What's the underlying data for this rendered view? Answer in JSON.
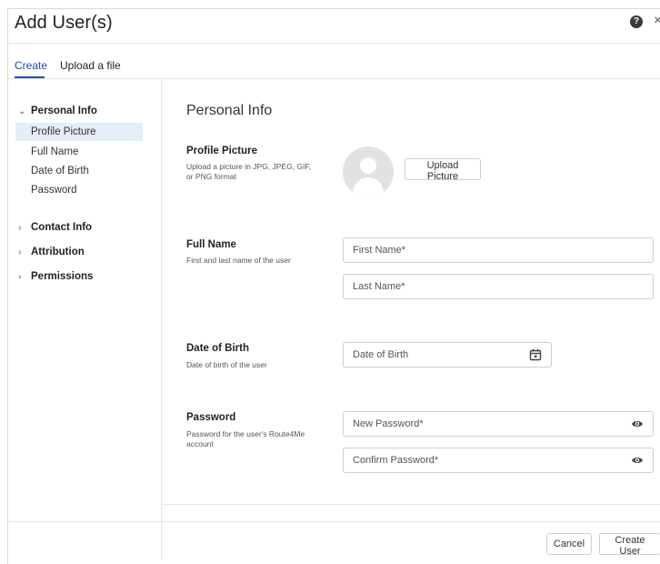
{
  "dialog": {
    "title": "Add User(s)",
    "help_icon": "help-icon",
    "close_glyph": "×"
  },
  "tabs": [
    {
      "label": "Create",
      "active": true
    },
    {
      "label": "Upload a file",
      "active": false
    }
  ],
  "sidebar": {
    "groups": [
      {
        "label": "Personal Info",
        "expanded": true,
        "items": [
          "Profile Picture",
          "Full Name",
          "Date of Birth",
          "Password"
        ],
        "selected": "Profile Picture"
      },
      {
        "label": "Contact Info",
        "expanded": false
      },
      {
        "label": "Attribution",
        "expanded": false
      },
      {
        "label": "Permissions",
        "expanded": false
      }
    ]
  },
  "main": {
    "section_title": "Personal Info",
    "profile_picture": {
      "label": "Profile Picture",
      "desc": "Upload a picture in JPG, JPEG, GIF, or PNG format",
      "button": "Upload Picture"
    },
    "full_name": {
      "label": "Full Name",
      "desc": "First and last name of the user",
      "first_placeholder": "First Name*",
      "last_placeholder": "Last Name*"
    },
    "date_of_birth": {
      "label": "Date of Birth",
      "desc": "Date of birth of the user",
      "placeholder": "Date of Birth"
    },
    "password": {
      "label": "Password",
      "desc": "Password for the user's Route4Me account",
      "new_placeholder": "New Password*",
      "confirm_placeholder": "Confirm Password*"
    }
  },
  "footer": {
    "cancel_label": "Cancel",
    "create_label": "Create User"
  },
  "colors": {
    "accent": "#1f4fb0",
    "selected_bg": "#e4edf8",
    "border": "#cfcfcf"
  }
}
